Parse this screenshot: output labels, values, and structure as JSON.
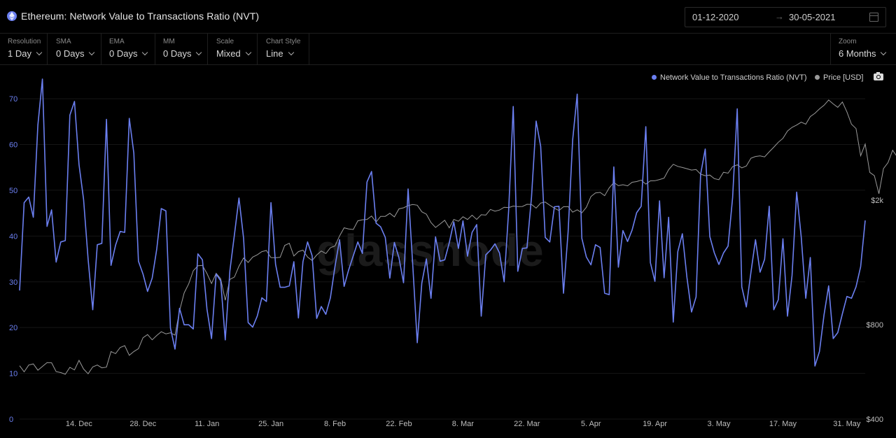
{
  "header": {
    "title": "Ethereum: Network Value to Transactions Ratio (NVT)",
    "date_from": "01-12-2020",
    "date_arrow": "→",
    "date_to": "30-05-2021"
  },
  "toolbar": {
    "controls": [
      {
        "label": "Resolution",
        "value": "1 Day"
      },
      {
        "label": "SMA",
        "value": "0 Days"
      },
      {
        "label": "EMA",
        "value": "0 Days"
      },
      {
        "label": "MM",
        "value": "0 Days"
      },
      {
        "label": "Scale",
        "value": "Mixed"
      },
      {
        "label": "Chart Style",
        "value": "Line"
      }
    ],
    "zoom": {
      "label": "Zoom",
      "value": "6 Months"
    }
  },
  "watermark": "glassnode",
  "colors": {
    "nvt": "#6b7ff0",
    "price": "#9a9a9a",
    "grid": "#161616",
    "axis_text_left": "#6b7ff0",
    "axis_text_right": "#bdbdbd"
  },
  "chart_data": {
    "type": "line",
    "title": "Ethereum: Network Value to Transactions Ratio (NVT)",
    "legend_position": "top-right",
    "grid": true,
    "x_start": "2020-12-01",
    "x_end": "2021-05-31",
    "x_ticks": [
      "14. Dec",
      "28. Dec",
      "11. Jan",
      "25. Jan",
      "8. Feb",
      "22. Feb",
      "8. Mar",
      "22. Mar",
      "5. Apr",
      "19. Apr",
      "3. May",
      "17. May",
      "31. May"
    ],
    "y_left": {
      "ticks": [
        "0",
        "10",
        "20",
        "30",
        "40",
        "50",
        "60",
        "70"
      ],
      "range": [
        0,
        72
      ]
    },
    "y_right": {
      "scale": "log",
      "ticks": [
        "$400",
        "$800",
        "$2k"
      ],
      "range": [
        400,
        4500
      ]
    },
    "series": [
      {
        "name": "Network Value to Transactions Ratio (NVT)",
        "axis": "left",
        "values": [
          28.1,
          47.3,
          48.5,
          44.1,
          64.2,
          74.3,
          42.1,
          45.7,
          34.3,
          38.7,
          39.0,
          66.4,
          69.4,
          55.6,
          48.0,
          34.9,
          23.9,
          38.1,
          38.4,
          65.5,
          33.6,
          38.0,
          41.0,
          40.8,
          65.7,
          58.1,
          34.5,
          31.7,
          27.9,
          30.8,
          37.1,
          46.0,
          45.5,
          19.9,
          15.3,
          24.2,
          20.6,
          20.6,
          19.7,
          36.1,
          34.8,
          24.0,
          17.6,
          31.7,
          30.2,
          17.3,
          32.4,
          40.3,
          48.3,
          39.5,
          21.1,
          20.1,
          22.5,
          26.5,
          25.7,
          47.3,
          33.8,
          28.8,
          28.8,
          29.1,
          34.4,
          22.1,
          34.4,
          38.7,
          35.7,
          22.0,
          24.6,
          22.9,
          26.5,
          33.4,
          39.2,
          29.0,
          32.6,
          35.7,
          38.7,
          36.2,
          51.8,
          54.1,
          42.8,
          42.0,
          39.7,
          30.8,
          38.6,
          35.2,
          29.8,
          50.3,
          33.8,
          16.7,
          29.7,
          35.0,
          26.4,
          39.8,
          34.5,
          34.8,
          38.5,
          43.1,
          37.3,
          43.3,
          35.6,
          40.8,
          42.5,
          22.5,
          35.9,
          36.9,
          38.3,
          36.3,
          30.0,
          45.7,
          68.3,
          32.3,
          37.3,
          37.4,
          48.5,
          65.1,
          59.6,
          39.7,
          38.7,
          46.4,
          46.5,
          27.5,
          40.9,
          61.0,
          71.0,
          39.5,
          35.4,
          33.7,
          38.1,
          37.5,
          27.5,
          27.2,
          55.1,
          33.2,
          41.2,
          38.8,
          41.3,
          45.1,
          46.5,
          63.9,
          34.2,
          30.1,
          47.7,
          30.9,
          44.1,
          21.2,
          36.6,
          40.5,
          31.0,
          23.4,
          26.7,
          53.5,
          59.0,
          39.9,
          36.3,
          33.8,
          36.3,
          37.8,
          48.4,
          67.8,
          28.9,
          24.5,
          32.1,
          39.2,
          32.1,
          34.9,
          46.5,
          23.9,
          26.1,
          39.4,
          22.5,
          31.4,
          49.6,
          39.8,
          26.4,
          35.3,
          11.6,
          14.8,
          22.8,
          29.1,
          17.6,
          18.9,
          23.0,
          26.8,
          26.4,
          28.9,
          33.3,
          43.4
        ]
      },
      {
        "name": "Price [USD]",
        "axis": "right",
        "values": [
          592,
          566,
          595,
          600,
          573,
          589,
          606,
          605,
          567,
          563,
          556,
          585,
          574,
          616,
          578,
          558,
          587,
          595,
          583,
          586,
          657,
          647,
          677,
          686,
          639,
          657,
          671,
          727,
          744,
          716,
          739,
          760,
          748,
          754,
          741,
          886,
          1011,
          1080,
          1189,
          1233,
          1237,
          1165,
          1083,
          1167,
          1121,
          957,
          1116,
          1136,
          1230,
          1306,
          1264,
          1315,
          1337,
          1369,
          1380,
          1310,
          1308,
          1312,
          1432,
          1455,
          1325,
          1369,
          1384,
          1315,
          1282,
          1335,
          1375,
          1349,
          1409,
          1427,
          1536,
          1630,
          1617,
          1610,
          1716,
          1729,
          1734,
          1778,
          1701,
          1773,
          1773,
          1814,
          1766,
          1874,
          1888,
          1919,
          1934,
          1924,
          1834,
          1802,
          1694,
          1634,
          1677,
          1723,
          1630,
          1734,
          1711,
          1768,
          1733,
          1789,
          1734,
          1795,
          1790,
          1866,
          1841,
          1857,
          1896,
          1891,
          1913,
          1906,
          1907,
          1937,
          1935,
          1883,
          1955,
          1969,
          1924,
          1882,
          1851,
          1903,
          1906,
          1829,
          1861,
          1820,
          1896,
          2051,
          2107,
          2114,
          2064,
          2186,
          2273,
          2221,
          2237,
          2219,
          2278,
          2289,
          2314,
          2248,
          2301,
          2304,
          2324,
          2348,
          2498,
          2599,
          2560,
          2539,
          2516,
          2491,
          2501,
          2418,
          2391,
          2401,
          2339,
          2321,
          2451,
          2435,
          2554,
          2589,
          2532,
          2568,
          2718,
          2754,
          2764,
          2745,
          2848,
          2946,
          3056,
          3146,
          3320,
          3410,
          3468,
          3542,
          3490,
          3690,
          3780,
          3905,
          4010,
          4168,
          4050,
          3950,
          4106,
          3820,
          3490,
          3380,
          2768,
          3015,
          2450,
          2390,
          2094,
          2518,
          2631,
          2882,
          2745,
          2491,
          2301,
          2440
        ]
      }
    ]
  }
}
